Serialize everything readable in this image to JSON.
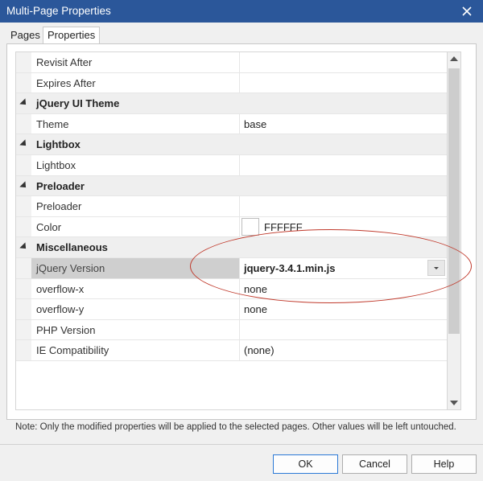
{
  "window": {
    "title": "Multi-Page Properties"
  },
  "tabs": [
    {
      "label": "Pages"
    },
    {
      "label": "Properties"
    }
  ],
  "grid": {
    "rows": [
      {
        "type": "prop",
        "name": "Revisit After",
        "value": ""
      },
      {
        "type": "prop",
        "name": "Expires After",
        "value": ""
      },
      {
        "type": "category",
        "name": "jQuery UI Theme"
      },
      {
        "type": "prop",
        "name": "Theme",
        "value": "base"
      },
      {
        "type": "category",
        "name": "Lightbox"
      },
      {
        "type": "prop",
        "name": "Lightbox",
        "value": ""
      },
      {
        "type": "category",
        "name": "Preloader"
      },
      {
        "type": "prop",
        "name": "Preloader",
        "value": ""
      },
      {
        "type": "prop",
        "name": "Color",
        "value": "FFFFFF",
        "swatch": "#FFFFFF"
      },
      {
        "type": "category",
        "name": "Miscellaneous"
      },
      {
        "type": "prop",
        "name": "jQuery Version",
        "value": "jquery-3.4.1.min.js",
        "selected": true
      },
      {
        "type": "prop",
        "name": "overflow-x",
        "value": "none"
      },
      {
        "type": "prop",
        "name": "overflow-y",
        "value": "none"
      },
      {
        "type": "prop",
        "name": "PHP Version",
        "value": ""
      },
      {
        "type": "prop",
        "name": "IE Compatibility",
        "value": "(none)"
      }
    ]
  },
  "note": "Note: Only the modified properties will be applied to the selected pages. Other values will be left untouched.",
  "buttons": {
    "ok": "OK",
    "cancel": "Cancel",
    "help": "Help"
  },
  "colors": {
    "titlebar": "#2b579a",
    "annotation": "#c0392b",
    "selected_row": "#cfcfcf"
  }
}
